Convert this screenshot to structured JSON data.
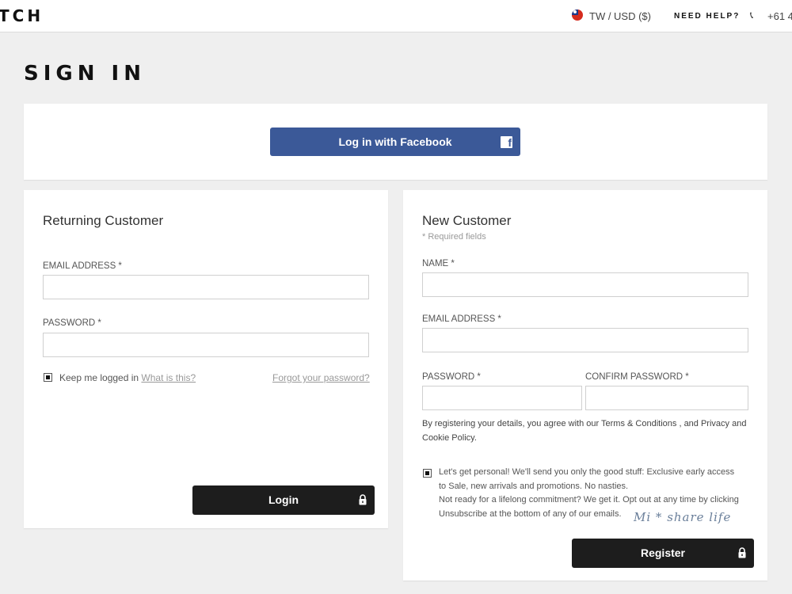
{
  "header": {
    "logo": "TCH",
    "locale": "TW / USD ($)",
    "need_help": "NEED HELP?",
    "phone": "+61 4"
  },
  "page_title": "SIGN IN",
  "facebook": {
    "label": "Log in with Facebook",
    "icon": "facebook-icon",
    "color": "#3b5998"
  },
  "returning": {
    "heading": "Returning Customer",
    "email_label": "EMAIL ADDRESS *",
    "email_value": "",
    "password_label": "PASSWORD *",
    "password_value": "",
    "keep_logged": "Keep me logged in",
    "what_is_this": "What is this?",
    "forgot": "Forgot your password?",
    "login_button": "Login"
  },
  "new_customer": {
    "heading": "New Customer",
    "required_note": "* Required fields",
    "name_label": "NAME *",
    "name_value": "",
    "email_label": "EMAIL ADDRESS *",
    "email_value": "",
    "password_label": "PASSWORD *",
    "password_value": "",
    "confirm_label": "CONFIRM PASSWORD *",
    "confirm_value": "",
    "terms_line1": "By registering your details, you agree with our Terms & Conditions , and Privacy and",
    "terms_line2": "Cookie Policy.",
    "optin_line1": "Let's get personal! We'll send you only the good stuff: Exclusive early access",
    "optin_line2": "to Sale, new arrivals and promotions. No nasties.",
    "optin_line3": "Not ready for a lifelong commitment? We get it. Opt out at any time by clicking",
    "optin_line4": "Unsubscribe at the bottom of any of our emails.",
    "register_button": "Register"
  },
  "watermark": "Mi * share life",
  "colors": {
    "background": "#efefef",
    "dark_button": "#1d1d1d",
    "facebook_blue": "#3b5998"
  }
}
